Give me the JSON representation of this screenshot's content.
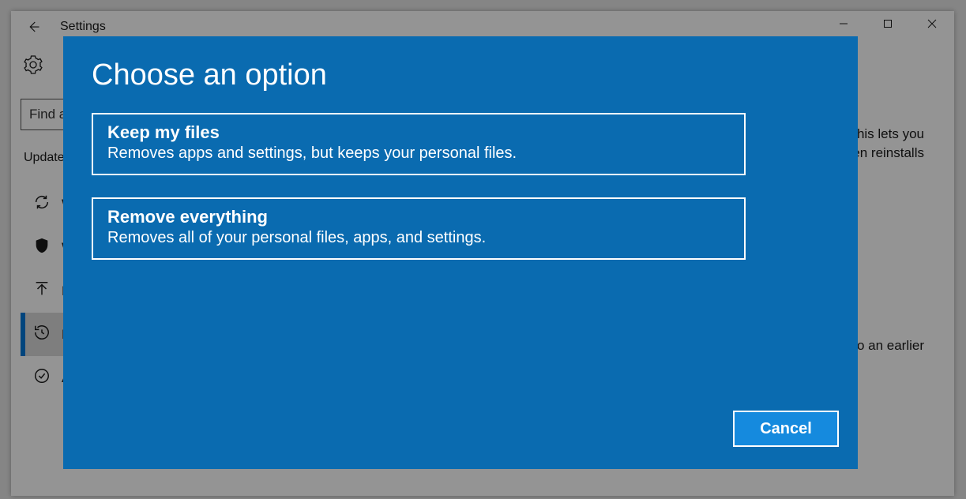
{
  "window": {
    "title": "Settings"
  },
  "sidebar": {
    "search_value": "Find a setting",
    "category": "Update & Security"
  },
  "nav": [
    "Windows Update",
    "Windows Security",
    "Backup",
    "Recovery",
    "Activation"
  ],
  "main": {
    "line1": "If your PC isn't running well, resetting it might help. This lets you",
    "line2": "choose to keep your personal files or remove them, and then reinstalls",
    "line3": "Go back to an earlier"
  },
  "modal": {
    "title": "Choose an option",
    "options": [
      {
        "title": "Keep my files",
        "desc": "Removes apps and settings, but keeps your personal files."
      },
      {
        "title": "Remove everything",
        "desc": "Removes all of your personal files, apps, and settings."
      }
    ],
    "cancel": "Cancel"
  }
}
